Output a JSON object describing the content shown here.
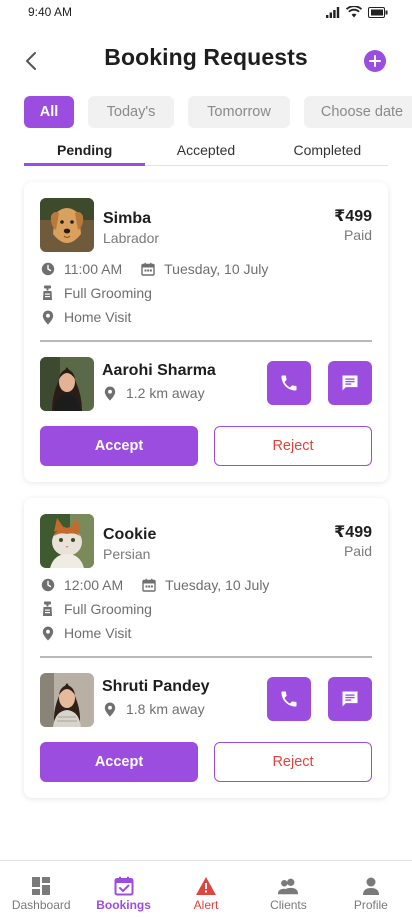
{
  "status_bar": {
    "time": "9:40 AM"
  },
  "header": {
    "title": "Booking Requests"
  },
  "filters": [
    "All",
    "Today's",
    "Tomorrow",
    "Choose date"
  ],
  "tabs": [
    "Pending",
    "Accepted",
    "Completed"
  ],
  "bookings": [
    {
      "pet_name": "Simba",
      "breed": "Labrador",
      "price": "₹499",
      "payment_status": "Paid",
      "time": "11:00 AM",
      "date": "Tuesday, 10 July",
      "service": "Full Grooming",
      "location": "Home Visit",
      "client_name": "Aarohi Sharma",
      "distance": "1.2 km away",
      "accept_label": "Accept",
      "reject_label": "Reject"
    },
    {
      "pet_name": "Cookie",
      "breed": "Persian",
      "price": "₹499",
      "payment_status": "Paid",
      "time": "12:00 AM",
      "date": "Tuesday, 10 July",
      "service": "Full Grooming",
      "location": "Home Visit",
      "client_name": "Shruti Pandey",
      "distance": "1.8 km away",
      "accept_label": "Accept",
      "reject_label": "Reject"
    }
  ],
  "bottom_nav": [
    "Dashboard",
    "Bookings",
    "Alert",
    "Clients",
    "Profile"
  ],
  "colors": {
    "accent": "#9b4de0",
    "alert": "#e0443e"
  },
  "icons": [
    "back-arrow-icon",
    "add-icon",
    "clock-icon",
    "calendar-icon",
    "grooming-icon",
    "location-pin-icon",
    "phone-icon",
    "chat-icon",
    "dashboard-icon",
    "bookings-icon",
    "alert-icon",
    "clients-icon",
    "profile-icon"
  ]
}
